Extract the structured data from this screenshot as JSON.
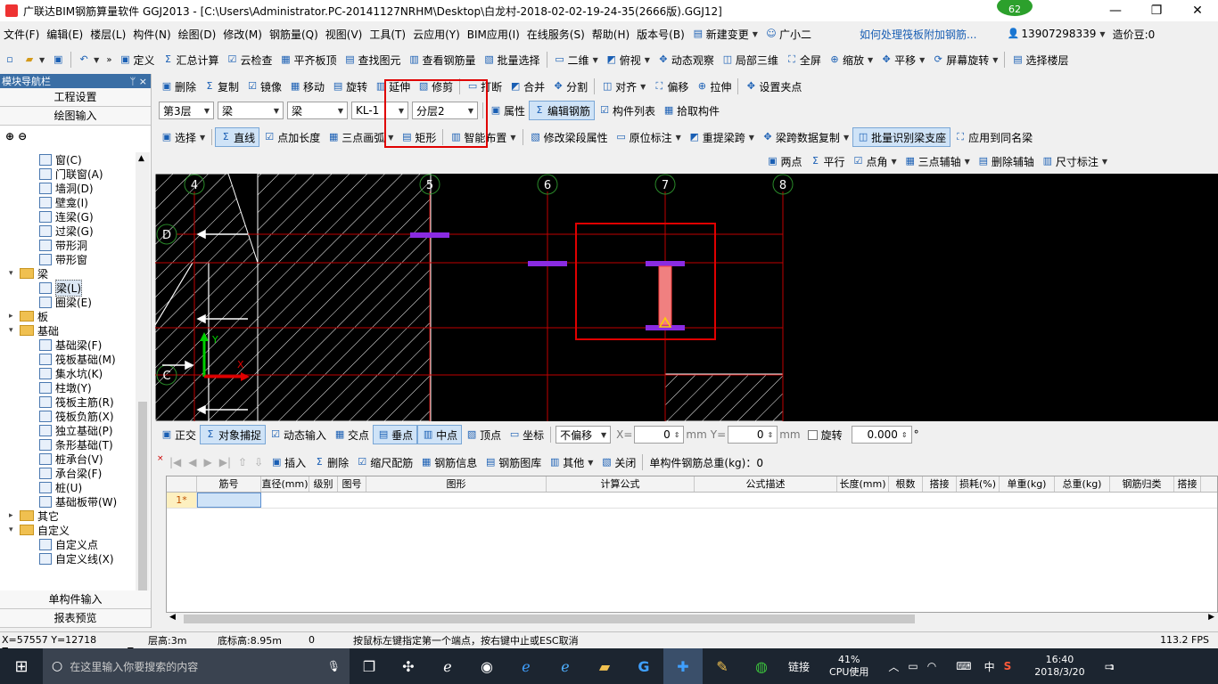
{
  "title": {
    "text": "广联达BIM钢筋算量软件 GGJ2013 - [C:\\Users\\Administrator.PC-20141127NRHM\\Desktop\\白龙村-2018-02-02-19-24-35(2666版).GGJ12]",
    "badge": "62"
  },
  "menu": [
    "文件(F)",
    "编辑(E)",
    "楼层(L)",
    "构件(N)",
    "绘图(D)",
    "修改(M)",
    "钢筋量(Q)",
    "视图(V)",
    "工具(T)",
    "云应用(Y)",
    "BIM应用(I)",
    "在线服务(S)",
    "帮助(H)",
    "版本号(B)"
  ],
  "menu_right": {
    "new_change": "新建变更",
    "guangxiaoer": "广小二",
    "question": "如何处理筏板附加钢筋...",
    "phone": "13907298339",
    "coins": "造价豆:0"
  },
  "toolbar1": [
    "定义",
    "汇总计算",
    "云检查",
    "平齐板顶",
    "查找图元",
    "查看钢筋量",
    "批量选择",
    "二维",
    "俯视",
    "动态观察",
    "局部三维",
    "全屏",
    "缩放",
    "平移",
    "屏幕旋转",
    "选择楼层"
  ],
  "toolbar2": [
    "删除",
    "复制",
    "镜像",
    "移动",
    "旋转",
    "延伸",
    "修剪",
    "打断",
    "合并",
    "分割",
    "对齐",
    "偏移",
    "拉伸",
    "设置夹点"
  ],
  "toolbar3": {
    "floor": "第3层",
    "type1": "梁",
    "type2": "梁",
    "member": "KL-1",
    "layer": "分层2",
    "items": [
      "属性",
      "编辑钢筋",
      "构件列表",
      "拾取构件"
    ]
  },
  "toolbar4": [
    "选择",
    "直线",
    "点加长度",
    "三点画弧",
    "矩形",
    "智能布置",
    "修改梁段属性",
    "原位标注",
    "重提梁跨",
    "梁跨数据复制",
    "批量识别梁支座",
    "应用到同名梁"
  ],
  "toolbar5": [
    "两点",
    "平行",
    "点角",
    "三点辅轴",
    "删除辅轴",
    "尺寸标注"
  ],
  "sidebar": {
    "header": "模块导航栏",
    "pin": "ᛘ ×",
    "top_buttons": [
      "工程设置",
      "绘图输入"
    ],
    "tree": [
      {
        "label": "窗(C)",
        "level": 2,
        "kind": "item"
      },
      {
        "label": "门联窗(A)",
        "level": 2,
        "kind": "item"
      },
      {
        "label": "墙洞(D)",
        "level": 2,
        "kind": "item"
      },
      {
        "label": "壁龛(I)",
        "level": 2,
        "kind": "item"
      },
      {
        "label": "连梁(G)",
        "level": 2,
        "kind": "item"
      },
      {
        "label": "过梁(G)",
        "level": 2,
        "kind": "item"
      },
      {
        "label": "带形洞",
        "level": 2,
        "kind": "item"
      },
      {
        "label": "带形窗",
        "level": 2,
        "kind": "item"
      },
      {
        "label": "梁",
        "level": 1,
        "kind": "folder",
        "open": true
      },
      {
        "label": "梁(L)",
        "level": 2,
        "kind": "item",
        "selected": true
      },
      {
        "label": "圈梁(E)",
        "level": 2,
        "kind": "item"
      },
      {
        "label": "板",
        "level": 1,
        "kind": "folder",
        "open": false
      },
      {
        "label": "基础",
        "level": 1,
        "kind": "folder",
        "open": true
      },
      {
        "label": "基础梁(F)",
        "level": 2,
        "kind": "item"
      },
      {
        "label": "筏板基础(M)",
        "level": 2,
        "kind": "item"
      },
      {
        "label": "集水坑(K)",
        "level": 2,
        "kind": "item"
      },
      {
        "label": "柱墩(Y)",
        "level": 2,
        "kind": "item"
      },
      {
        "label": "筏板主筋(R)",
        "level": 2,
        "kind": "item"
      },
      {
        "label": "筏板负筋(X)",
        "level": 2,
        "kind": "item"
      },
      {
        "label": "独立基础(P)",
        "level": 2,
        "kind": "item"
      },
      {
        "label": "条形基础(T)",
        "level": 2,
        "kind": "item"
      },
      {
        "label": "桩承台(V)",
        "level": 2,
        "kind": "item"
      },
      {
        "label": "承台梁(F)",
        "level": 2,
        "kind": "item"
      },
      {
        "label": "桩(U)",
        "level": 2,
        "kind": "item"
      },
      {
        "label": "基础板带(W)",
        "level": 2,
        "kind": "item"
      },
      {
        "label": "其它",
        "level": 1,
        "kind": "folder",
        "open": false
      },
      {
        "label": "自定义",
        "level": 1,
        "kind": "folder",
        "open": true
      },
      {
        "label": "自定义点",
        "level": 2,
        "kind": "item"
      },
      {
        "label": "自定义线(X)",
        "level": 2,
        "kind": "item"
      }
    ],
    "bottom_buttons": [
      "单构件输入",
      "报表预览"
    ]
  },
  "canvas": {
    "axis_labels": [
      {
        "label": "4",
        "axis": "x"
      },
      {
        "label": "5",
        "axis": "x"
      },
      {
        "label": "6",
        "axis": "x"
      },
      {
        "label": "7",
        "axis": "x"
      },
      {
        "label": "8",
        "axis": "x"
      },
      {
        "label": "D",
        "axis": "y"
      },
      {
        "label": "C",
        "axis": "y"
      }
    ],
    "ucs_x": "X",
    "ucs_y": "Y"
  },
  "snapbar": {
    "items": [
      "正交",
      "对象捕捉",
      "动态输入",
      "交点",
      "垂点",
      "中点",
      "顶点",
      "坐标"
    ],
    "offset": "不偏移",
    "x_label": "X=",
    "x_value": "0",
    "unit": "mm",
    "y_label": "Y=",
    "y_value": "0",
    "rotate_label": "旋转",
    "rotate_value": "0.000",
    "deg": "°"
  },
  "gridtb": {
    "items": [
      "插入",
      "删除",
      "缩尺配筋",
      "钢筋信息",
      "钢筋图库",
      "其他",
      "关闭"
    ],
    "total_label": "单构件钢筋总重(kg)：0"
  },
  "grid": {
    "columns": [
      "筋号",
      "直径(mm)",
      "级别",
      "图号",
      "图形",
      "计算公式",
      "公式描述",
      "长度(mm)",
      "根数",
      "搭接",
      "损耗(%)",
      "单重(kg)",
      "总重(kg)",
      "钢筋归类",
      "搭接形"
    ],
    "row_marker": "1*"
  },
  "status": {
    "coords": "X=57557 Y=12718",
    "floor_height": "层高:3m",
    "base_height": "底标高:8.95m",
    "zero": "0",
    "hint": "按鼠标左键指定第一个端点，按右键中止或ESC取消",
    "fps": "113.2 FPS"
  },
  "taskbar": {
    "search_placeholder": "在这里输入你要搜索的内容",
    "link": "链接",
    "cpu": "41%",
    "cpu_label": "CPU使用",
    "ime": "中",
    "time": "16:40",
    "date": "2018/3/20",
    "notif": "1"
  },
  "colors": {
    "accent": "#e00000",
    "beam_support": "#8a2be2",
    "beam_body": "#f08080",
    "axis_grid": "#c00000"
  }
}
